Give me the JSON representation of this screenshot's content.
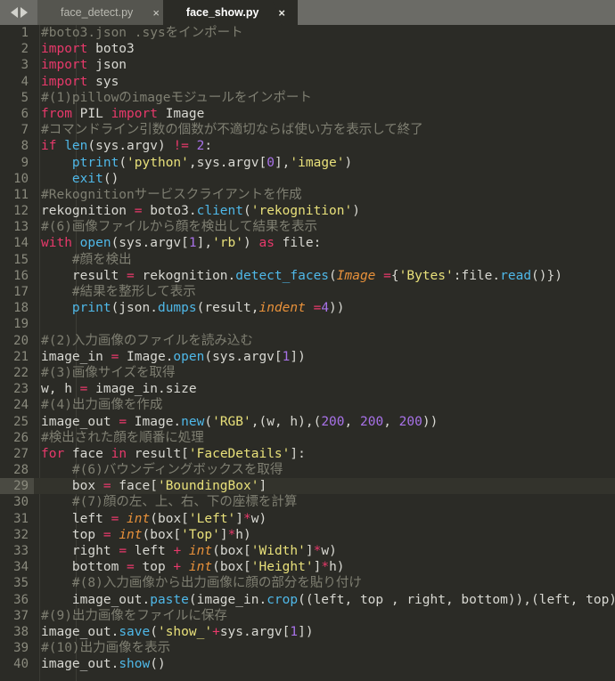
{
  "tabbar": {
    "nav_prev_icon": "arrow-left-icon",
    "nav_next_icon": "arrow-right-icon",
    "close_glyph": "×",
    "tabs": [
      {
        "label": "face_detect.py",
        "active": false
      },
      {
        "label": "face_show.py",
        "active": true
      }
    ]
  },
  "editor": {
    "current_line": 29,
    "colors": {
      "background": "#2b2b26",
      "tabbar_background": "#6b6b66",
      "inactive_tab": "#55554f",
      "comment": "#7f7f72",
      "keyword": "#e8396b",
      "function": "#4fb8e8",
      "string": "#e8e07a",
      "number": "#a872e8",
      "kwarg": "#e8913a",
      "text": "#e8e8e2",
      "lineno": "#8a8a7d",
      "current_line_bg": "#33332c"
    },
    "lines": [
      {
        "n": 1,
        "tokens": [
          {
            "t": "cm",
            "v": "#boto3.json .sysをインポート"
          }
        ]
      },
      {
        "n": 2,
        "tokens": [
          {
            "t": "kw",
            "v": "import"
          },
          {
            "t": "pn",
            "v": " boto3"
          }
        ]
      },
      {
        "n": 3,
        "tokens": [
          {
            "t": "kw",
            "v": "import"
          },
          {
            "t": "pn",
            "v": " json"
          }
        ]
      },
      {
        "n": 4,
        "tokens": [
          {
            "t": "kw",
            "v": "import"
          },
          {
            "t": "pn",
            "v": " sys"
          }
        ]
      },
      {
        "n": 5,
        "tokens": [
          {
            "t": "cm",
            "v": "#(1)pillowのimageモジュールをインポート"
          }
        ]
      },
      {
        "n": 6,
        "tokens": [
          {
            "t": "kw",
            "v": "from"
          },
          {
            "t": "pn",
            "v": " PIL "
          },
          {
            "t": "kw",
            "v": "import"
          },
          {
            "t": "pn",
            "v": " Image"
          }
        ]
      },
      {
        "n": 7,
        "tokens": [
          {
            "t": "cm",
            "v": "#コマンドライン引数の個数が不適切ならば使い方を表示して終了"
          }
        ]
      },
      {
        "n": 8,
        "tokens": [
          {
            "t": "kw",
            "v": "if"
          },
          {
            "t": "pn",
            "v": " "
          },
          {
            "t": "fn",
            "v": "len"
          },
          {
            "t": "pn",
            "v": "(sys.argv) "
          },
          {
            "t": "op",
            "v": "!="
          },
          {
            "t": "pn",
            "v": " "
          },
          {
            "t": "nu",
            "v": "2"
          },
          {
            "t": "pn",
            "v": ":"
          }
        ]
      },
      {
        "n": 9,
        "tokens": [
          {
            "t": "pn",
            "v": "    "
          },
          {
            "t": "fn",
            "v": "ptrint"
          },
          {
            "t": "pn",
            "v": "("
          },
          {
            "t": "st",
            "v": "'python'"
          },
          {
            "t": "pn",
            "v": ",sys.argv["
          },
          {
            "t": "nu",
            "v": "0"
          },
          {
            "t": "pn",
            "v": "],"
          },
          {
            "t": "st",
            "v": "'image'"
          },
          {
            "t": "pn",
            "v": ")"
          }
        ]
      },
      {
        "n": 10,
        "tokens": [
          {
            "t": "pn",
            "v": "    "
          },
          {
            "t": "fn",
            "v": "exit"
          },
          {
            "t": "pn",
            "v": "()"
          }
        ]
      },
      {
        "n": 11,
        "tokens": [
          {
            "t": "cm",
            "v": "#Rekognitionサービスクライアントを作成"
          }
        ]
      },
      {
        "n": 12,
        "tokens": [
          {
            "t": "pn",
            "v": "rekognition "
          },
          {
            "t": "op",
            "v": "="
          },
          {
            "t": "pn",
            "v": " boto3."
          },
          {
            "t": "fn",
            "v": "client"
          },
          {
            "t": "pn",
            "v": "("
          },
          {
            "t": "st",
            "v": "'rekognition'"
          },
          {
            "t": "pn",
            "v": ")"
          }
        ]
      },
      {
        "n": 13,
        "tokens": [
          {
            "t": "cm",
            "v": "#(6)画像ファイルから顔を検出して結果を表示"
          }
        ]
      },
      {
        "n": 14,
        "tokens": [
          {
            "t": "kw",
            "v": "with"
          },
          {
            "t": "pn",
            "v": " "
          },
          {
            "t": "fn",
            "v": "open"
          },
          {
            "t": "pn",
            "v": "(sys.argv["
          },
          {
            "t": "nu",
            "v": "1"
          },
          {
            "t": "pn",
            "v": "],"
          },
          {
            "t": "st",
            "v": "'rb'"
          },
          {
            "t": "pn",
            "v": ") "
          },
          {
            "t": "kw2",
            "v": "as"
          },
          {
            "t": "pn",
            "v": " file:"
          }
        ]
      },
      {
        "n": 15,
        "tokens": [
          {
            "t": "pn",
            "v": "    "
          },
          {
            "t": "cm",
            "v": "#顔を検出"
          }
        ]
      },
      {
        "n": 16,
        "tokens": [
          {
            "t": "pn",
            "v": "    result "
          },
          {
            "t": "op",
            "v": "="
          },
          {
            "t": "pn",
            "v": " rekognition."
          },
          {
            "t": "fn",
            "v": "detect_faces"
          },
          {
            "t": "pn",
            "v": "("
          },
          {
            "t": "kwarg",
            "v": "Image "
          },
          {
            "t": "op",
            "v": "="
          },
          {
            "t": "pn",
            "v": "{"
          },
          {
            "t": "st",
            "v": "'Bytes'"
          },
          {
            "t": "pn",
            "v": ":file."
          },
          {
            "t": "fn",
            "v": "read"
          },
          {
            "t": "pn",
            "v": "()})"
          }
        ]
      },
      {
        "n": 17,
        "tokens": [
          {
            "t": "pn",
            "v": "    "
          },
          {
            "t": "cm",
            "v": "#結果を整形して表示"
          }
        ]
      },
      {
        "n": 18,
        "tokens": [
          {
            "t": "pn",
            "v": "    "
          },
          {
            "t": "fn",
            "v": "print"
          },
          {
            "t": "pn",
            "v": "(json."
          },
          {
            "t": "fn",
            "v": "dumps"
          },
          {
            "t": "pn",
            "v": "(result,"
          },
          {
            "t": "kwarg",
            "v": "indent "
          },
          {
            "t": "op",
            "v": "="
          },
          {
            "t": "nu",
            "v": "4"
          },
          {
            "t": "pn",
            "v": "))"
          }
        ]
      },
      {
        "n": 19,
        "tokens": [
          {
            "t": "pn",
            "v": ""
          }
        ]
      },
      {
        "n": 20,
        "tokens": [
          {
            "t": "cm",
            "v": "#(2)入力画像のファイルを読み込む"
          }
        ]
      },
      {
        "n": 21,
        "tokens": [
          {
            "t": "pn",
            "v": "image_in "
          },
          {
            "t": "op",
            "v": "="
          },
          {
            "t": "pn",
            "v": " Image."
          },
          {
            "t": "fn",
            "v": "open"
          },
          {
            "t": "pn",
            "v": "(sys.argv["
          },
          {
            "t": "nu",
            "v": "1"
          },
          {
            "t": "pn",
            "v": "])"
          }
        ]
      },
      {
        "n": 22,
        "tokens": [
          {
            "t": "cm",
            "v": "#(3)画像サイズを取得"
          }
        ]
      },
      {
        "n": 23,
        "tokens": [
          {
            "t": "pn",
            "v": "w, h "
          },
          {
            "t": "op",
            "v": "="
          },
          {
            "t": "pn",
            "v": " image_in.size"
          }
        ]
      },
      {
        "n": 24,
        "tokens": [
          {
            "t": "cm",
            "v": "#(4)出力画像を作成"
          }
        ]
      },
      {
        "n": 25,
        "tokens": [
          {
            "t": "pn",
            "v": "image_out "
          },
          {
            "t": "op",
            "v": "="
          },
          {
            "t": "pn",
            "v": " Image."
          },
          {
            "t": "fn",
            "v": "new"
          },
          {
            "t": "pn",
            "v": "("
          },
          {
            "t": "st",
            "v": "'RGB'"
          },
          {
            "t": "pn",
            "v": ",(w, h),("
          },
          {
            "t": "nu",
            "v": "200"
          },
          {
            "t": "pn",
            "v": ", "
          },
          {
            "t": "nu",
            "v": "200"
          },
          {
            "t": "pn",
            "v": ", "
          },
          {
            "t": "nu",
            "v": "200"
          },
          {
            "t": "pn",
            "v": "))"
          }
        ]
      },
      {
        "n": 26,
        "tokens": [
          {
            "t": "cm",
            "v": "#検出された顔を順番に処理"
          }
        ]
      },
      {
        "n": 27,
        "tokens": [
          {
            "t": "kw",
            "v": "for"
          },
          {
            "t": "pn",
            "v": " face "
          },
          {
            "t": "kw2",
            "v": "in"
          },
          {
            "t": "pn",
            "v": " result["
          },
          {
            "t": "st",
            "v": "'FaceDetails'"
          },
          {
            "t": "pn",
            "v": "]:"
          }
        ]
      },
      {
        "n": 28,
        "tokens": [
          {
            "t": "pn",
            "v": "    "
          },
          {
            "t": "cm",
            "v": "#(6)バウンディングボックスを取得"
          }
        ]
      },
      {
        "n": 29,
        "tokens": [
          {
            "t": "pn",
            "v": "    box "
          },
          {
            "t": "op",
            "v": "="
          },
          {
            "t": "pn",
            "v": " face["
          },
          {
            "t": "st",
            "v": "'BoundingBox'"
          },
          {
            "t": "pn",
            "v": "]"
          }
        ]
      },
      {
        "n": 30,
        "tokens": [
          {
            "t": "pn",
            "v": "    "
          },
          {
            "t": "cm",
            "v": "#(7)顔の左、上、右、下の座標を計算"
          }
        ]
      },
      {
        "n": 31,
        "tokens": [
          {
            "t": "pn",
            "v": "    left "
          },
          {
            "t": "op",
            "v": "="
          },
          {
            "t": "pn",
            "v": " "
          },
          {
            "t": "kwarg",
            "v": "int"
          },
          {
            "t": "pn",
            "v": "(box["
          },
          {
            "t": "st",
            "v": "'Left'"
          },
          {
            "t": "pn",
            "v": "]"
          },
          {
            "t": "pl",
            "v": "*"
          },
          {
            "t": "pn",
            "v": "w)"
          }
        ]
      },
      {
        "n": 32,
        "tokens": [
          {
            "t": "pn",
            "v": "    top "
          },
          {
            "t": "op",
            "v": "="
          },
          {
            "t": "pn",
            "v": " "
          },
          {
            "t": "kwarg",
            "v": "int"
          },
          {
            "t": "pn",
            "v": "(box["
          },
          {
            "t": "st",
            "v": "'Top'"
          },
          {
            "t": "pn",
            "v": "]"
          },
          {
            "t": "pl",
            "v": "*"
          },
          {
            "t": "pn",
            "v": "h)"
          }
        ]
      },
      {
        "n": 33,
        "tokens": [
          {
            "t": "pn",
            "v": "    right "
          },
          {
            "t": "op",
            "v": "="
          },
          {
            "t": "pn",
            "v": " left "
          },
          {
            "t": "pl",
            "v": "+"
          },
          {
            "t": "pn",
            "v": " "
          },
          {
            "t": "kwarg",
            "v": "int"
          },
          {
            "t": "pn",
            "v": "(box["
          },
          {
            "t": "st",
            "v": "'Width'"
          },
          {
            "t": "pn",
            "v": "]"
          },
          {
            "t": "pl",
            "v": "*"
          },
          {
            "t": "pn",
            "v": "w)"
          }
        ]
      },
      {
        "n": 34,
        "tokens": [
          {
            "t": "pn",
            "v": "    bottom "
          },
          {
            "t": "op",
            "v": "="
          },
          {
            "t": "pn",
            "v": " top "
          },
          {
            "t": "pl",
            "v": "+"
          },
          {
            "t": "pn",
            "v": " "
          },
          {
            "t": "kwarg",
            "v": "int"
          },
          {
            "t": "pn",
            "v": "(box["
          },
          {
            "t": "st",
            "v": "'Height'"
          },
          {
            "t": "pn",
            "v": "]"
          },
          {
            "t": "pl",
            "v": "*"
          },
          {
            "t": "pn",
            "v": "h)"
          }
        ]
      },
      {
        "n": 35,
        "tokens": [
          {
            "t": "pn",
            "v": "    "
          },
          {
            "t": "cm",
            "v": "#(8)入力画像から出力画像に顔の部分を貼り付け"
          }
        ]
      },
      {
        "n": 36,
        "tokens": [
          {
            "t": "pn",
            "v": "    image_out."
          },
          {
            "t": "fn",
            "v": "paste"
          },
          {
            "t": "pn",
            "v": "(image_in."
          },
          {
            "t": "fn",
            "v": "crop"
          },
          {
            "t": "pn",
            "v": "((left, top , right, bottom)),(left, top))"
          }
        ]
      },
      {
        "n": 37,
        "tokens": [
          {
            "t": "cm",
            "v": "#(9)出力画像をファイルに保存"
          }
        ]
      },
      {
        "n": 38,
        "tokens": [
          {
            "t": "pn",
            "v": "image_out."
          },
          {
            "t": "fn",
            "v": "save"
          },
          {
            "t": "pn",
            "v": "("
          },
          {
            "t": "st",
            "v": "'show_'"
          },
          {
            "t": "pl",
            "v": "+"
          },
          {
            "t": "pn",
            "v": "sys.argv["
          },
          {
            "t": "nu",
            "v": "1"
          },
          {
            "t": "pn",
            "v": "])"
          }
        ]
      },
      {
        "n": 39,
        "tokens": [
          {
            "t": "cm",
            "v": "#(10)出力画像を表示"
          }
        ]
      },
      {
        "n": 40,
        "tokens": [
          {
            "t": "pn",
            "v": "image_out."
          },
          {
            "t": "fn",
            "v": "show"
          },
          {
            "t": "pn",
            "v": "()"
          }
        ]
      }
    ]
  }
}
